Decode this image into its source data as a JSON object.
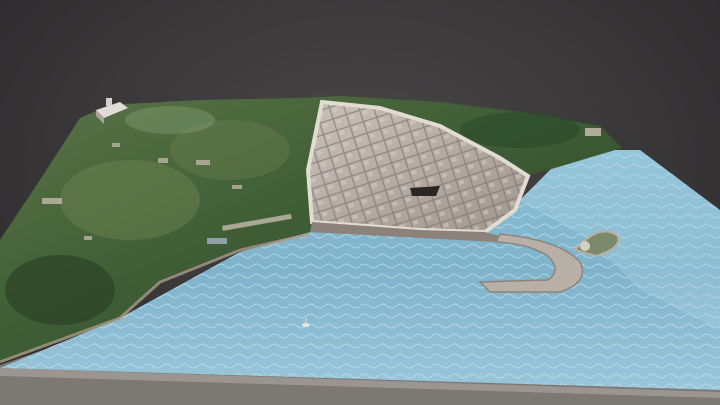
{
  "scene": {
    "subject": "3d-terrain-model-coastal-walled-town",
    "colors": {
      "background": "#3a3739",
      "terrain_dark": "#2f4a2c",
      "terrain_mid": "#4d6b3e",
      "terrain_light": "#6f8452",
      "sea": "#7fb3cc",
      "sea_light": "#a9d2e3",
      "town_stone": "#b9b0a8",
      "town_shadow": "#6e6660",
      "model_base": "#8a8580"
    }
  }
}
